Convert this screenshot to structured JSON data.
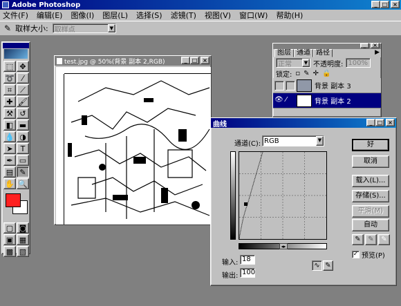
{
  "app": {
    "title": "Adobe Photoshop"
  },
  "menu": [
    "文件(F)",
    "编辑(E)",
    "图像(I)",
    "图层(L)",
    "选择(S)",
    "滤镜(T)",
    "视图(V)",
    "窗口(W)",
    "帮助(H)"
  ],
  "options": {
    "sample_label": "取样大小:",
    "sample_value": "取样点"
  },
  "image_window": {
    "title": "test.jpg @ 50%(背景 副本 2,RGB)"
  },
  "layers_panel": {
    "tabs": [
      "图层",
      "通道",
      "路径"
    ],
    "blend_mode": "正常",
    "opacity_label": "不透明度:",
    "opacity_value": "100%",
    "lock_label": "锁定:",
    "layers": [
      {
        "name": "背景 副本 3"
      },
      {
        "name": "背景 副本 2"
      }
    ]
  },
  "curves": {
    "title": "曲线",
    "channel_label": "通道(C):",
    "channel_value": "RGB",
    "ok": "好",
    "cancel": "取消",
    "load": "载入(L)...",
    "save": "存储(S)...",
    "smooth": "平滑(M)",
    "auto": "自动",
    "preview": "预览(P)",
    "input_label": "输入:",
    "input_value": "18",
    "output_label": "输出:",
    "output_value": "100"
  },
  "colors": {
    "foreground": "#ff2020",
    "background": "#ffffff",
    "title_active": "#000080"
  }
}
